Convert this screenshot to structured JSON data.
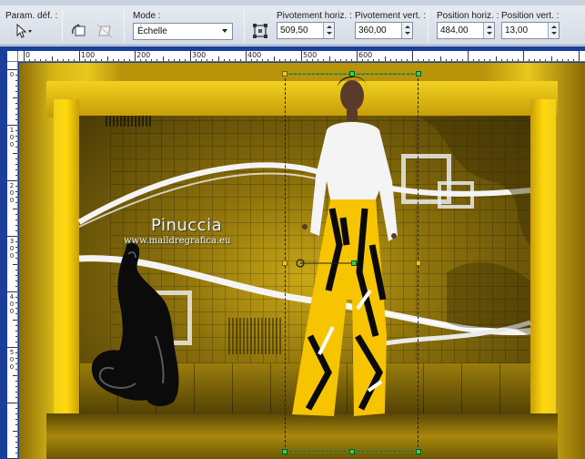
{
  "toolbar": {
    "preset_label": "Param. déf. :",
    "mode_label": "Mode :",
    "mode_value": "Échelle",
    "pivot_h_label": "Pivotement horiz. :",
    "pivot_h_value": "509,50",
    "pivot_v_label": "Pivotement vert. :",
    "pivot_v_value": "360,00",
    "pos_h_label": "Position horiz. :",
    "pos_h_value": "484,00",
    "pos_v_label": "Position vert. :",
    "pos_v_value": "13,00"
  },
  "ruler": {
    "h_labels": [
      "0",
      "100",
      "200",
      "300",
      "400",
      "500",
      "600"
    ],
    "v_labels": [
      "0",
      "100",
      "200",
      "300",
      "400",
      "500"
    ]
  },
  "canvas": {
    "watermark": "Pinuccia",
    "watermark_url": "www.maildregrafica.eu"
  },
  "colors": {
    "accent_yellow": "#f0cf16",
    "handle_green": "#2fd25a",
    "workspace_blue": "#1a3f9a"
  }
}
